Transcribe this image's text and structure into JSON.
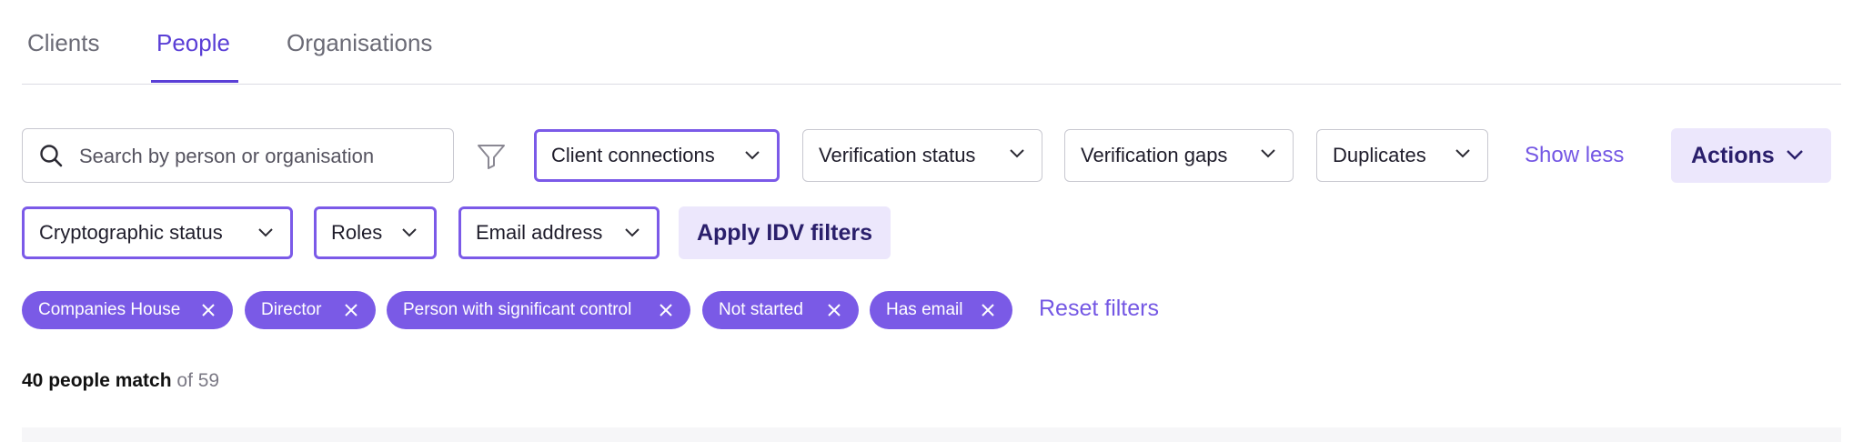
{
  "tabs": [
    {
      "label": "Clients",
      "active": false
    },
    {
      "label": "People",
      "active": true
    },
    {
      "label": "Organisations",
      "active": false
    }
  ],
  "search": {
    "placeholder": "Search by person or organisation",
    "value": ""
  },
  "filters_row1": [
    {
      "label": "Client connections",
      "active": true
    },
    {
      "label": "Verification status",
      "active": false
    },
    {
      "label": "Verification gaps",
      "active": false
    },
    {
      "label": "Duplicates",
      "active": false
    }
  ],
  "show_less_label": "Show less",
  "actions_label": "Actions",
  "filters_row2": [
    {
      "label": "Cryptographic status",
      "active": true
    },
    {
      "label": "Roles",
      "active": true
    },
    {
      "label": "Email address",
      "active": true
    }
  ],
  "apply_label": "Apply IDV filters",
  "chips": [
    {
      "label": "Companies House"
    },
    {
      "label": "Director"
    },
    {
      "label": "Person with significant control"
    },
    {
      "label": "Not started"
    },
    {
      "label": "Has email"
    }
  ],
  "reset_label": "Reset filters",
  "result": {
    "match": "40 people match",
    "total": "of 59"
  },
  "colors": {
    "accent": "#7a5ae6",
    "accent_text": "#5a3fd6",
    "accent_bg": "#ece7fc"
  }
}
